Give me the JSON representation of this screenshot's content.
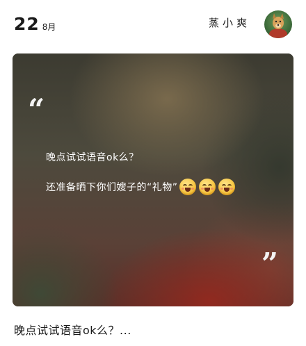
{
  "header": {
    "day": "22",
    "month": "8月",
    "username": "蒸小爽"
  },
  "card": {
    "open_quote": "“",
    "close_quote": "”",
    "lines": [
      "晚点试试语音ok么？",
      "还准备晒下你们嫂子的“礼物”"
    ],
    "emoji_icon": "grinning-face-icon"
  },
  "post": {
    "summary": "晚点试试语音ok么？..."
  }
}
